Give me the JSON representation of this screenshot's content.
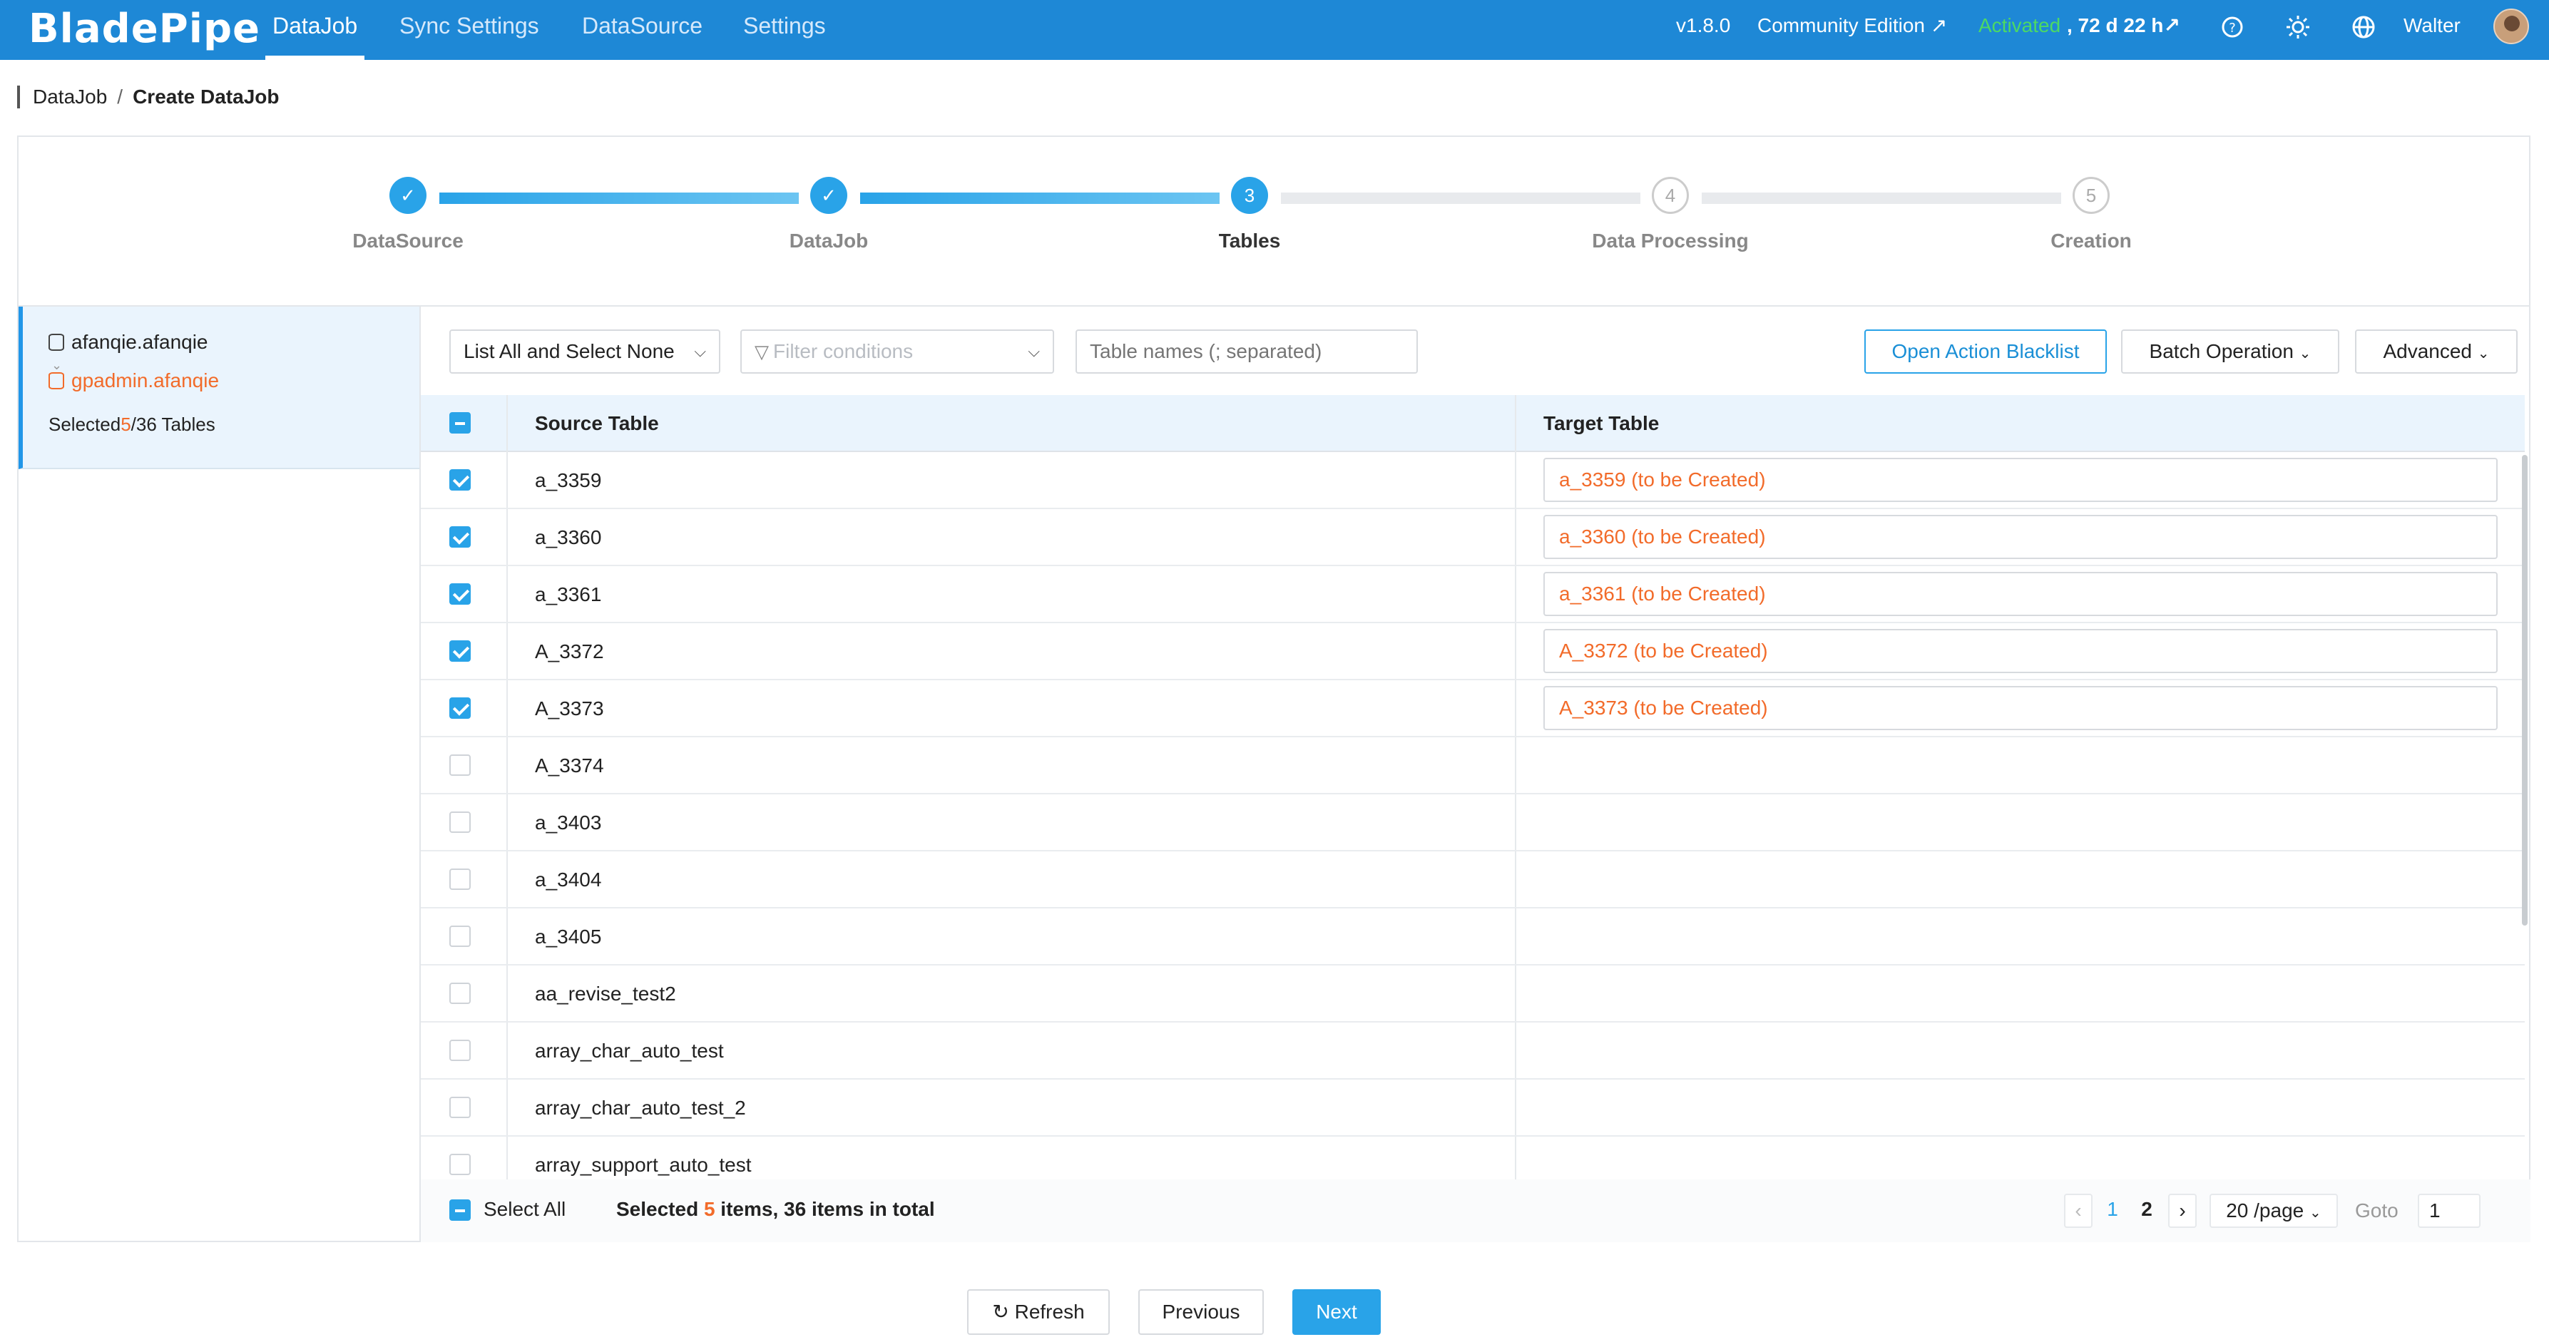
{
  "app": {
    "logo": "BladePipe",
    "nav": [
      "DataJob",
      "Sync Settings",
      "DataSource",
      "Settings"
    ],
    "version": "v1.8.0",
    "edition": "Community Edition ↗",
    "activated": "Activated",
    "remaining": ", 72 d 22 h↗",
    "user": "Walter"
  },
  "breadcrumb": {
    "root": "DataJob",
    "sep": "/",
    "current": "Create DataJob"
  },
  "steps": [
    {
      "label": "DataSource",
      "status": "done",
      "mark": "✓"
    },
    {
      "label": "DataJob",
      "status": "done",
      "mark": "✓"
    },
    {
      "label": "Tables",
      "status": "current",
      "mark": "3"
    },
    {
      "label": "Data Processing",
      "status": "pending",
      "mark": "4"
    },
    {
      "label": "Creation",
      "status": "pending",
      "mark": "5"
    }
  ],
  "left": {
    "source_db": "afanqie.afanqie",
    "target_db": "gpadmin.afanqie",
    "selected_prefix": "Selected ",
    "selected_count": "5",
    "selected_suffix": " /36 Tables"
  },
  "toolbar": {
    "list_mode": "List All and Select None",
    "filter_placeholder": "Filter conditions",
    "table_names_placeholder": "Table names (; separated)",
    "blacklist_button": "Open Action Blacklist",
    "batch_button": "Batch Operation",
    "advanced_button": "Advanced"
  },
  "table": {
    "header_source": "Source Table",
    "header_target": "Target Table",
    "rows": [
      {
        "source": "a_3359",
        "target": "a_3359 (to be Created)",
        "checked": true
      },
      {
        "source": "a_3360",
        "target": "a_3360 (to be Created)",
        "checked": true
      },
      {
        "source": "a_3361",
        "target": "a_3361 (to be Created)",
        "checked": true
      },
      {
        "source": "A_3372",
        "target": "A_3372 (to be Created)",
        "checked": true
      },
      {
        "source": "A_3373",
        "target": "A_3373 (to be Created)",
        "checked": true
      },
      {
        "source": "A_3374",
        "target": "",
        "checked": false
      },
      {
        "source": "a_3403",
        "target": "",
        "checked": false
      },
      {
        "source": "a_3404",
        "target": "",
        "checked": false
      },
      {
        "source": "a_3405",
        "target": "",
        "checked": false
      },
      {
        "source": "aa_revise_test2",
        "target": "",
        "checked": false
      },
      {
        "source": "array_char_auto_test",
        "target": "",
        "checked": false
      },
      {
        "source": "array_char_auto_test_2",
        "target": "",
        "checked": false
      },
      {
        "source": "array_support_auto_test",
        "target": "",
        "checked": false
      }
    ]
  },
  "footer_bar": {
    "select_all": "Select All",
    "summary_prefix": "Selected ",
    "summary_count": "5",
    "summary_suffix": " items, 36 items in total",
    "pages": [
      "1",
      "2"
    ],
    "page_size": "20 /page",
    "goto_label": "Goto",
    "goto_value": "1"
  },
  "actions": {
    "refresh": "Refresh",
    "previous": "Previous",
    "next": "Next"
  },
  "colors": {
    "nav_bg": "#1e88d6",
    "accent": "#29a3e8",
    "highlight": "#f26b2a",
    "activated": "#4cd964"
  }
}
